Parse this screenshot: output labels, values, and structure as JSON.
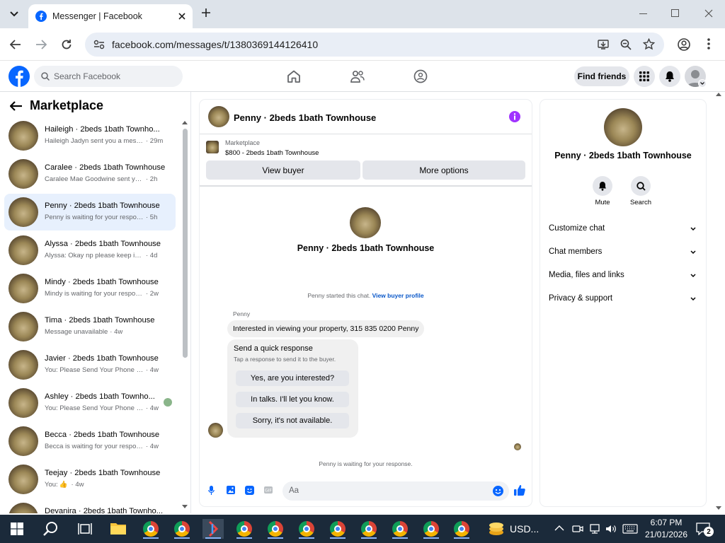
{
  "browser": {
    "tab_title": "Messenger | Facebook",
    "url": "facebook.com/messages/t/1380369144126410"
  },
  "fb": {
    "search_placeholder": "Search Facebook",
    "find_friends": "Find friends"
  },
  "left": {
    "title": "Marketplace",
    "conversations": [
      {
        "name": "Haileigh · 2beds 1bath Townho...",
        "preview": "Haileigh Jadyn sent you a messa...",
        "time": "· 29m"
      },
      {
        "name": "Caralee · 2beds 1bath Townhouse",
        "preview": "Caralee Mae Goodwine sent you a...",
        "time": "· 2h"
      },
      {
        "name": "Penny · 2beds 1bath Townhouse",
        "preview": "Penny is waiting for your response.",
        "time": "· 5h"
      },
      {
        "name": "Alyssa · 2beds 1bath Townhouse",
        "preview": "Alyssa: Okay np please keep in mi...",
        "time": "· 4d"
      },
      {
        "name": "Mindy · 2beds 1bath Townhouse",
        "preview": "Mindy is waiting for your response.",
        "time": "· 2w"
      },
      {
        "name": "Tima · 2beds 1bath Townhouse",
        "preview": "Message unavailable",
        "time": "· 4w"
      },
      {
        "name": "Javier · 2beds 1bath Townhouse",
        "preview": "You: Please Send Your Phone Num...",
        "time": "· 4w"
      },
      {
        "name": "Ashley · 2beds 1bath Townho...",
        "preview": "You: Please Send Your Phone N...",
        "time": "· 4w"
      },
      {
        "name": "Becca · 2beds 1bath Townhouse",
        "preview": "Becca is waiting for your response.",
        "time": "· 4w"
      },
      {
        "name": "Teejay · 2beds 1bath Townhouse",
        "preview": "You:",
        "time": "· 4w"
      },
      {
        "name": "Deyanira · 2beds 1bath Townho...",
        "preview": "",
        "time": ""
      }
    ]
  },
  "chat": {
    "header_title": "Penny · 2beds 1bath Townhouse",
    "listing_label": "Marketplace",
    "listing_title": "$800 - 2beds 1bath Townhouse",
    "view_buyer": "View buyer",
    "more_options": "More options",
    "profile_name": "Penny · 2beds 1bath Townhouse",
    "started_text": "Penny started this chat.",
    "view_buyer_profile": "View buyer profile",
    "sender_name": "Penny",
    "message": "Interested in viewing your property, 315 835 0200  Penny",
    "quick_title": "Send a quick response",
    "quick_sub": "Tap a response to send it to the buyer.",
    "quick_responses": [
      "Yes, are you interested?",
      "In talks. I'll let you know.",
      "Sorry, it's not available."
    ],
    "waiting_text": "Penny is waiting for your response.",
    "composer_placeholder": "Aa"
  },
  "info": {
    "name": "Penny · 2beds 1bath Townhouse",
    "mute": "Mute",
    "search": "Search",
    "sections": [
      "Customize chat",
      "Chat members",
      "Media, files and links",
      "Privacy & support"
    ]
  },
  "taskbar": {
    "currency": "USD...",
    "time": "6:07 PM",
    "date": "21/01/2026",
    "notif_count": "2"
  },
  "colors": {
    "fb_blue": "#0866ff",
    "messenger_purple": "#a033ff",
    "active_row": "#e7f0fd"
  }
}
